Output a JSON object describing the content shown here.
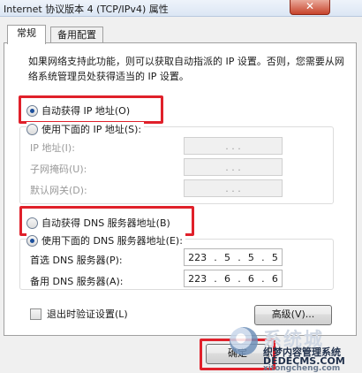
{
  "window": {
    "title": "Internet 协议版本 4 (TCP/IPv4) 属性",
    "close_label": "✕"
  },
  "tabs": [
    {
      "label": "常规",
      "active": true
    },
    {
      "label": "备用配置",
      "active": false
    }
  ],
  "description": "如果网络支持此功能，则可以获取自动指派的 IP 设置。否则，您需要从网络系统管理员处获得适当的 IP 设置。",
  "ip_section": {
    "auto_label": "自动获得 IP 地址(O)",
    "auto_checked": true,
    "manual_label": "使用下面的 IP 地址(S):",
    "manual_checked": false,
    "fields": [
      {
        "label": "IP 地址(I):",
        "value": ".     .     ."
      },
      {
        "label": "子网掩码(U):",
        "value": ".     .     ."
      },
      {
        "label": "默认网关(D):",
        "value": ".     .     ."
      }
    ]
  },
  "dns_section": {
    "auto_label": "自动获得 DNS 服务器地址(B)",
    "auto_checked": false,
    "manual_label": "使用下面的 DNS 服务器地址(E):",
    "manual_checked": true,
    "fields": [
      {
        "label": "首选 DNS 服务器(P):",
        "octets": [
          "223",
          "5",
          "5",
          "5"
        ]
      },
      {
        "label": "备用 DNS 服务器(A):",
        "octets": [
          "223",
          "6",
          "6",
          "6"
        ]
      }
    ]
  },
  "validate_on_exit": {
    "label": "退出时验证设置(L)",
    "checked": false
  },
  "advanced_button": "高级(V)...",
  "ok_button": "确定",
  "watermark": {
    "brand": "系统城",
    "line1": "织梦内容管理系统",
    "line2": "DEDECMS.COM",
    "line3": "xitongcheng.com"
  },
  "colors": {
    "highlight": "#e0202a",
    "radio_dot": "#1b4f9c"
  }
}
